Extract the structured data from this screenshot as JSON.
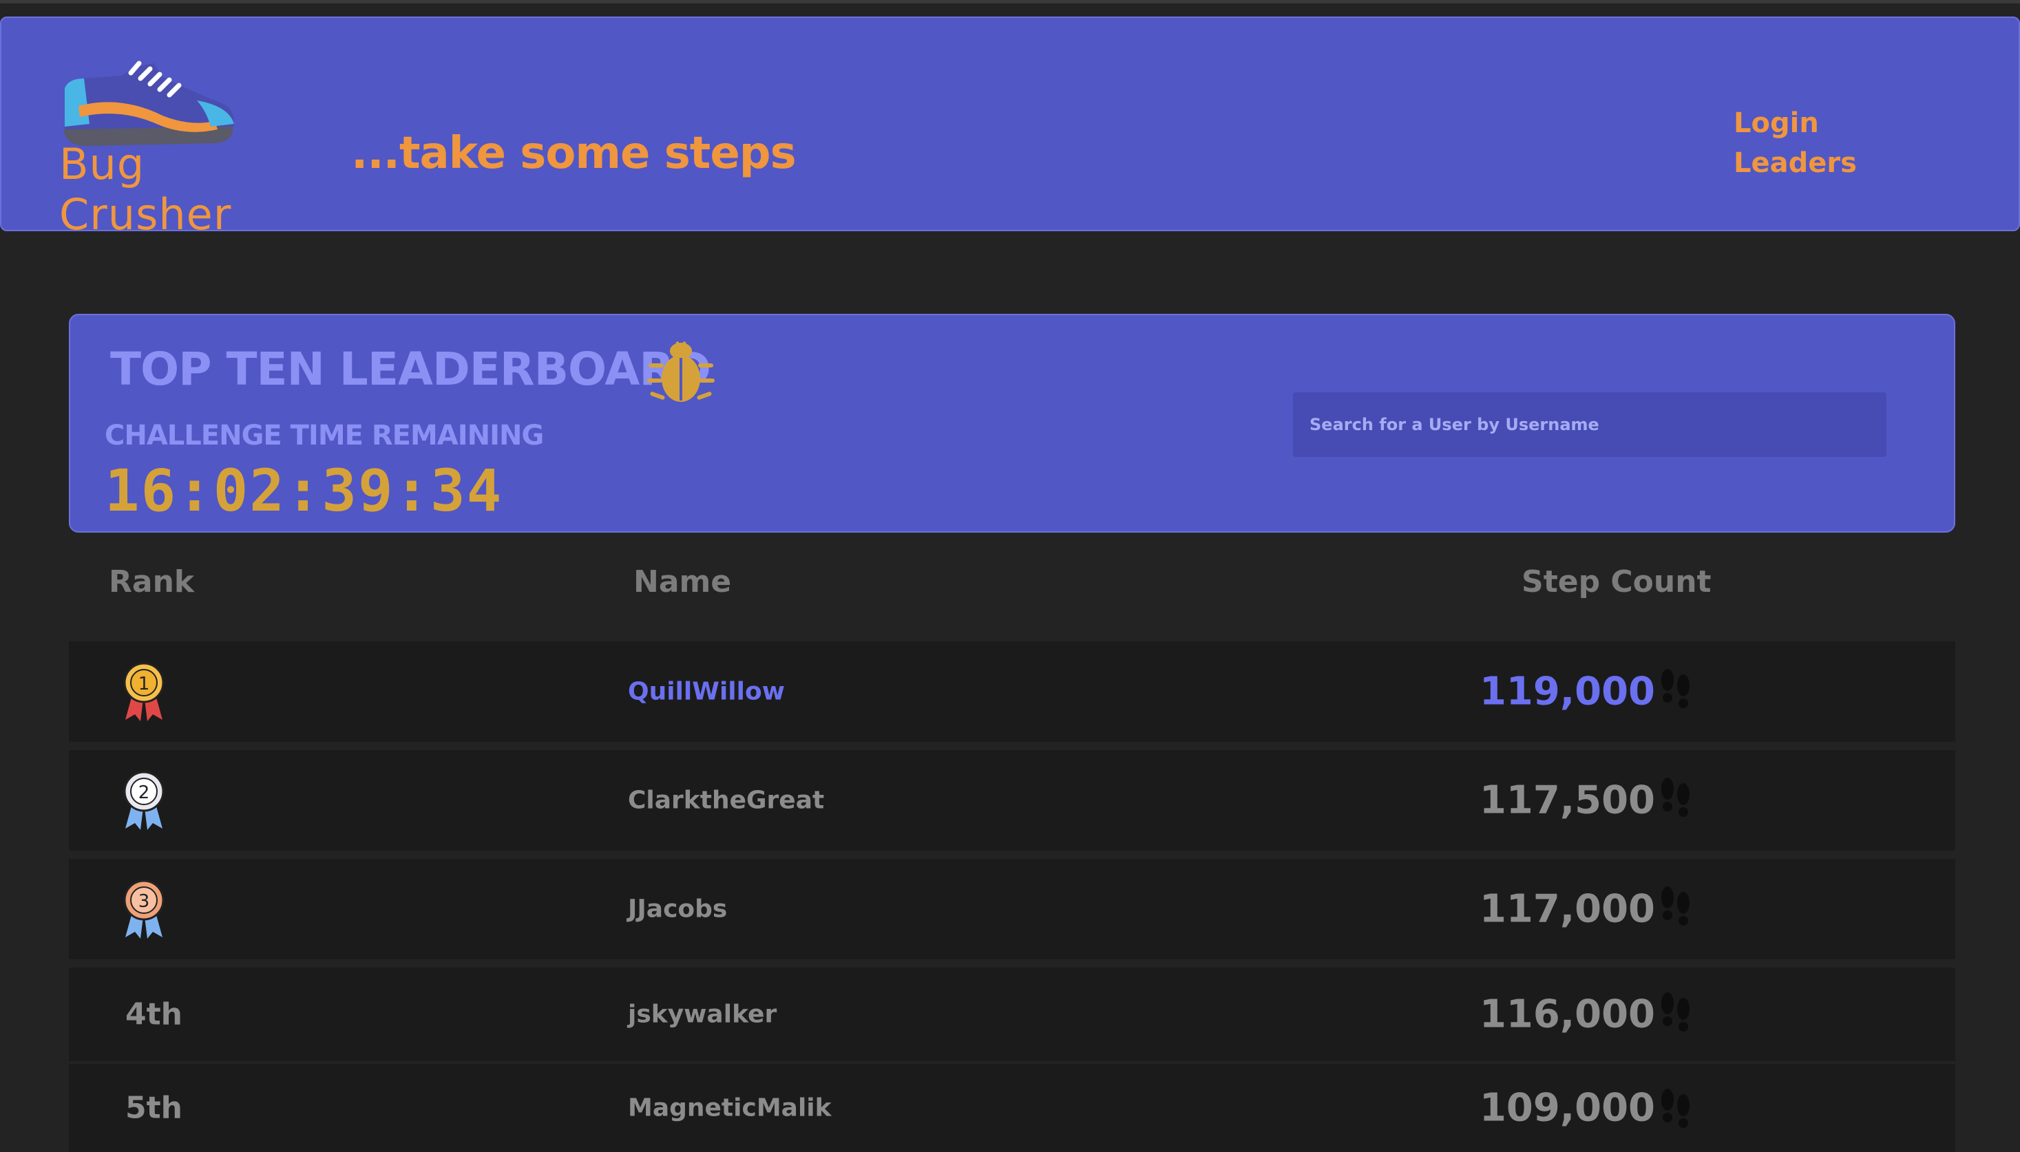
{
  "brand": {
    "name": "Bug Crusher",
    "tagline": "...take some steps",
    "logo_icon": "sneaker-icon"
  },
  "nav": {
    "items": [
      {
        "label": "Login"
      },
      {
        "label": "Leaders"
      }
    ]
  },
  "leaderboard": {
    "title": "TOP TEN LEADERBOARD",
    "title_icon": "bug-icon",
    "countdown_label": "CHALLENGE TIME REMAINING",
    "countdown_value": "16:02:39:34",
    "search_placeholder": "Search for a User by Username"
  },
  "table": {
    "columns": [
      "Rank",
      "Name",
      "Step Count"
    ],
    "rows": [
      {
        "rank": "1",
        "rank_icon": "gold-medal-icon",
        "name": "QuillWillow",
        "steps": "119,000"
      },
      {
        "rank": "2",
        "rank_icon": "silver-medal-icon",
        "name": "ClarktheGreat",
        "steps": "117,500"
      },
      {
        "rank": "3",
        "rank_icon": "bronze-medal-icon",
        "name": "JJacobs",
        "steps": "117,000"
      },
      {
        "rank": "4th",
        "name": "jskywalker",
        "steps": "116,000"
      },
      {
        "rank": "5th",
        "name": "MagneticMalik",
        "steps": "109,000"
      }
    ]
  },
  "colors": {
    "accent": "#5157c5",
    "brand_orange": "#f0963e",
    "timer_gold": "#d5a23a",
    "leader_blue": "#6a70f0",
    "background": "#232323"
  }
}
